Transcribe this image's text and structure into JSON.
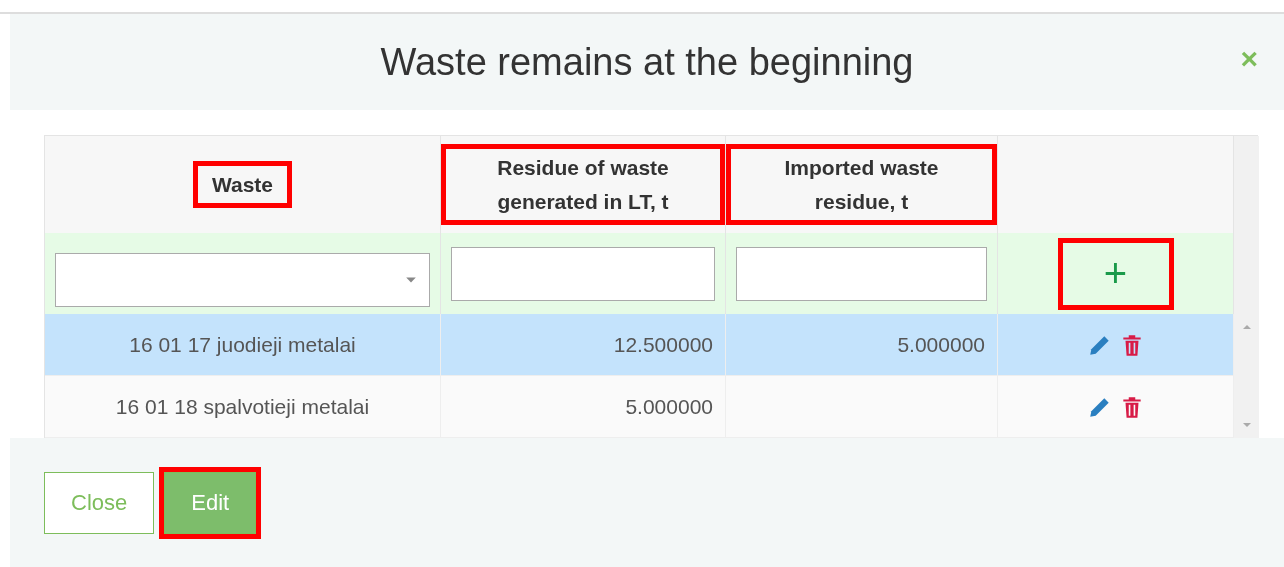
{
  "dialog": {
    "title": "Waste remains at the beginning",
    "close_icon": "×"
  },
  "table": {
    "columns": [
      {
        "label": "Waste",
        "highlighted": true
      },
      {
        "label": "Residue of waste generated in LT, t",
        "highlighted": true
      },
      {
        "label": "Imported waste residue, t",
        "highlighted": true
      }
    ],
    "add_button": {
      "label": "+",
      "highlighted": true
    },
    "rows": [
      {
        "waste": "16 01 17 juodieji metalai",
        "generated": "12.500000",
        "imported": "5.000000",
        "selected": true
      },
      {
        "waste": "16 01 18 spalvotieji metalai",
        "generated": "5.000000",
        "imported": "",
        "selected": false
      }
    ]
  },
  "buttons": [
    {
      "label": "Close",
      "kind": "outline",
      "highlighted": false
    },
    {
      "label": "Edit",
      "kind": "primary",
      "highlighted": true
    }
  ]
}
